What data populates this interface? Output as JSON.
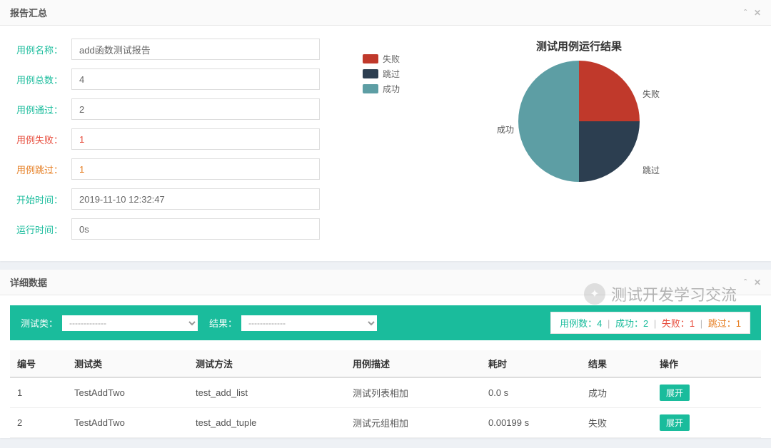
{
  "summary_panel": {
    "title": "报告汇总",
    "labels": {
      "case_name": "用例名称：",
      "case_total": "用例总数：",
      "case_pass": "用例通过：",
      "case_fail": "用例失败：",
      "case_skip": "用例跳过：",
      "start_time": "开始时间：",
      "run_time": "运行时间："
    },
    "values": {
      "case_name": "add函数测试报告",
      "case_total": "4",
      "case_pass": "2",
      "case_fail": "1",
      "case_skip": "1",
      "start_time": "2019-11-10 12:32:47",
      "run_time": "0s"
    }
  },
  "chart_data": {
    "type": "pie",
    "title": "测试用例运行结果",
    "series": [
      {
        "name": "失败",
        "value": 1,
        "color": "#c0392b"
      },
      {
        "name": "跳过",
        "value": 1,
        "color": "#2c3e50"
      },
      {
        "name": "成功",
        "value": 2,
        "color": "#5d9ea4"
      }
    ],
    "legend_labels": {
      "fail": "失败",
      "skip": "跳过",
      "pass": "成功"
    }
  },
  "detail_panel": {
    "title": "详细数据",
    "filter_labels": {
      "test_class": "测试类：",
      "result": "结果："
    },
    "filter_placeholder": "-------------",
    "stats": {
      "total_label": "用例数：",
      "total_value": "4",
      "pass_label": "成功：",
      "pass_value": "2",
      "fail_label": "失败：",
      "fail_value": "1",
      "skip_label": "跳过：",
      "skip_value": "1"
    },
    "columns": {
      "id": "编号",
      "cls": "测试类",
      "method": "测试方法",
      "desc": "用例描述",
      "time": "耗时",
      "result": "结果",
      "action": "操作"
    },
    "rows": [
      {
        "id": "1",
        "cls": "TestAddTwo",
        "method": "test_add_list",
        "desc": "测试列表相加",
        "time": "0.0 s",
        "result": "成功",
        "result_class": "c-teal",
        "action": "展开"
      },
      {
        "id": "2",
        "cls": "TestAddTwo",
        "method": "test_add_tuple",
        "desc": "测试元组相加",
        "time": "0.00199 s",
        "result": "失败",
        "result_class": "c-red",
        "action": "展开"
      }
    ]
  },
  "watermark": "测试开发学习交流"
}
